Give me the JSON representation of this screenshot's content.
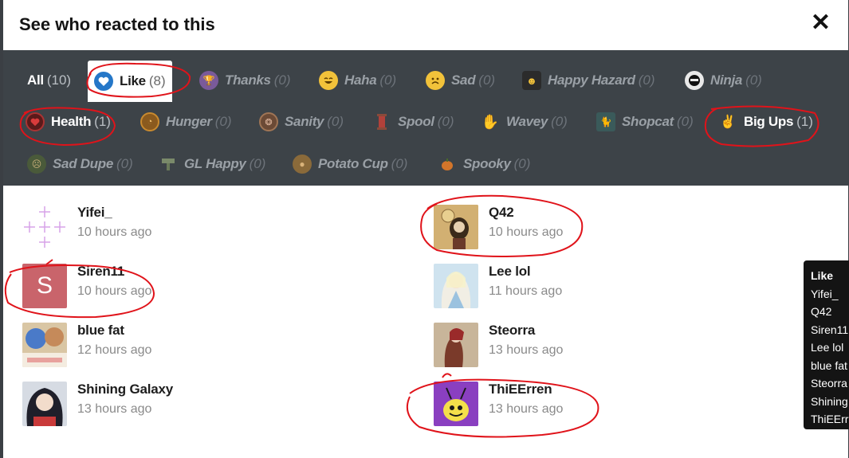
{
  "dialog": {
    "title": "See who reacted to this",
    "close_label": "✕"
  },
  "tabs": [
    {
      "label": "All",
      "count": "(10)"
    },
    {
      "label": "Like",
      "count": "(8)"
    },
    {
      "label": "Thanks",
      "count": "(0)"
    },
    {
      "label": "Haha",
      "count": "(0)"
    },
    {
      "label": "Sad",
      "count": "(0)"
    },
    {
      "label": "Happy Hazard",
      "count": "(0)"
    },
    {
      "label": "Ninja",
      "count": "(0)"
    },
    {
      "label": "Health",
      "count": "(1)"
    },
    {
      "label": "Hunger",
      "count": "(0)"
    },
    {
      "label": "Sanity",
      "count": "(0)"
    },
    {
      "label": "Spool",
      "count": "(0)"
    },
    {
      "label": "Wavey",
      "count": "(0)"
    },
    {
      "label": "Shopcat",
      "count": "(0)"
    },
    {
      "label": "Big Ups",
      "count": "(1)"
    },
    {
      "label": "Sad Dupe",
      "count": "(0)"
    },
    {
      "label": "GL Happy",
      "count": "(0)"
    },
    {
      "label": "Potato Cup",
      "count": "(0)"
    },
    {
      "label": "Spooky",
      "count": "(0)"
    }
  ],
  "users": [
    {
      "name": "Yifei_",
      "time": "10 hours ago"
    },
    {
      "name": "Q42",
      "time": "10 hours ago"
    },
    {
      "name": "Siren11",
      "time": "10 hours ago",
      "avatar_letter": "S"
    },
    {
      "name": "Lee lol",
      "time": "11 hours ago"
    },
    {
      "name": "blue fat",
      "time": "12 hours ago"
    },
    {
      "name": "Steorra",
      "time": "13 hours ago"
    },
    {
      "name": "Shining Galaxy",
      "time": "13 hours ago"
    },
    {
      "name": "ThiEErren",
      "time": "13 hours ago"
    }
  ],
  "tooltip": {
    "title": "Like",
    "names": [
      "Yifei_",
      "Q42",
      "Siren11",
      "Lee lol",
      "blue fat",
      "Steorra",
      "Shining",
      "ThiEErren"
    ]
  },
  "colors": {
    "tabbar_bg": "#3d4348",
    "like_blue": "#2577c8",
    "annotation_red": "#e0131a",
    "siren_avatar": "#c9646b"
  }
}
